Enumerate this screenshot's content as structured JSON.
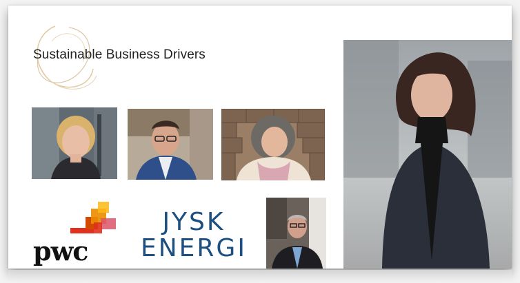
{
  "slide": {
    "title": "Sustainable Business Drivers"
  },
  "logos": {
    "pwc": {
      "wordmark": "pwc",
      "brand_colors": [
        "#fdb913",
        "#eb8c00",
        "#e0301e",
        "#d04a02",
        "#db536a"
      ]
    },
    "jysk_energi": {
      "line1": "JYSK",
      "line2": "ENERGI",
      "color": "#1d4f80"
    }
  },
  "photos": [
    {
      "name": "portrait-woman-blonde"
    },
    {
      "name": "portrait-man-glasses-suit"
    },
    {
      "name": "portrait-woman-curly-hair"
    },
    {
      "name": "portrait-man-glasses-small"
    },
    {
      "name": "portrait-woman-dark-hair-large"
    }
  ]
}
